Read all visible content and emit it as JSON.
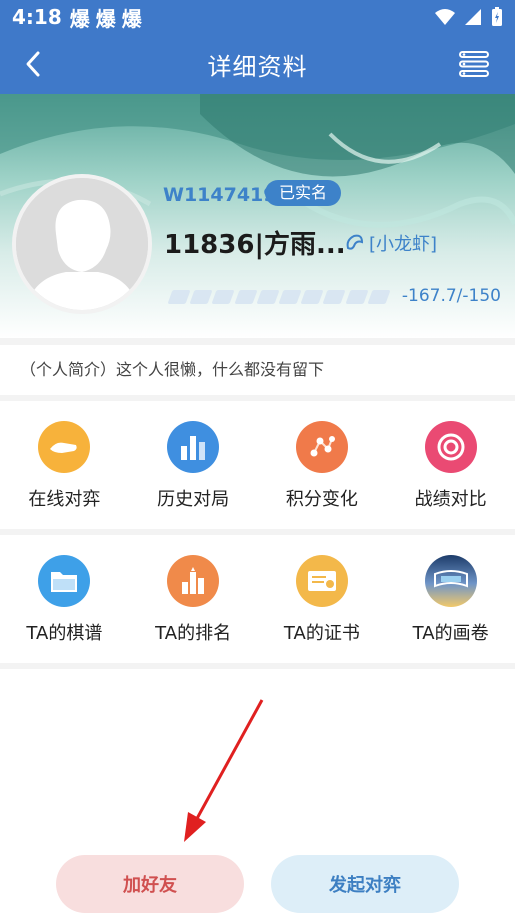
{
  "status_bar": {
    "time": "4:18",
    "notifications": [
      "爆",
      "爆",
      "爆"
    ]
  },
  "header": {
    "title": "详细资料"
  },
  "profile": {
    "user_id": "W1147419",
    "verified_badge": "已实名",
    "nickname": "11836|方雨...",
    "rank": "[小龙虾]",
    "score": "-167.7/-150",
    "progress_segments": 10
  },
  "intro": "（个人简介）这个人很懒，什么都没有留下",
  "grid_row1": [
    {
      "label": "在线对弈",
      "icon": "handshake-icon",
      "color": "#f7b23b"
    },
    {
      "label": "历史对局",
      "icon": "bar-chart-icon",
      "color": "#3f8fe0"
    },
    {
      "label": "积分变化",
      "icon": "network-icon",
      "color": "#f07a4a"
    },
    {
      "label": "战绩对比",
      "icon": "target-icon",
      "color": "#ea4a73"
    }
  ],
  "grid_row2": [
    {
      "label": "TA的棋谱",
      "icon": "folder-icon",
      "color": "#3ea0e8"
    },
    {
      "label": "TA的排名",
      "icon": "ranking-icon",
      "color": "#f08a4a"
    },
    {
      "label": "TA的证书",
      "icon": "certificate-icon",
      "color": "#f3b84a"
    },
    {
      "label": "TA的画卷",
      "icon": "scroll-painting-icon",
      "color": "#2f4a7a"
    }
  ],
  "buttons": {
    "add_friend": "加好友",
    "start_game": "发起对弈"
  }
}
